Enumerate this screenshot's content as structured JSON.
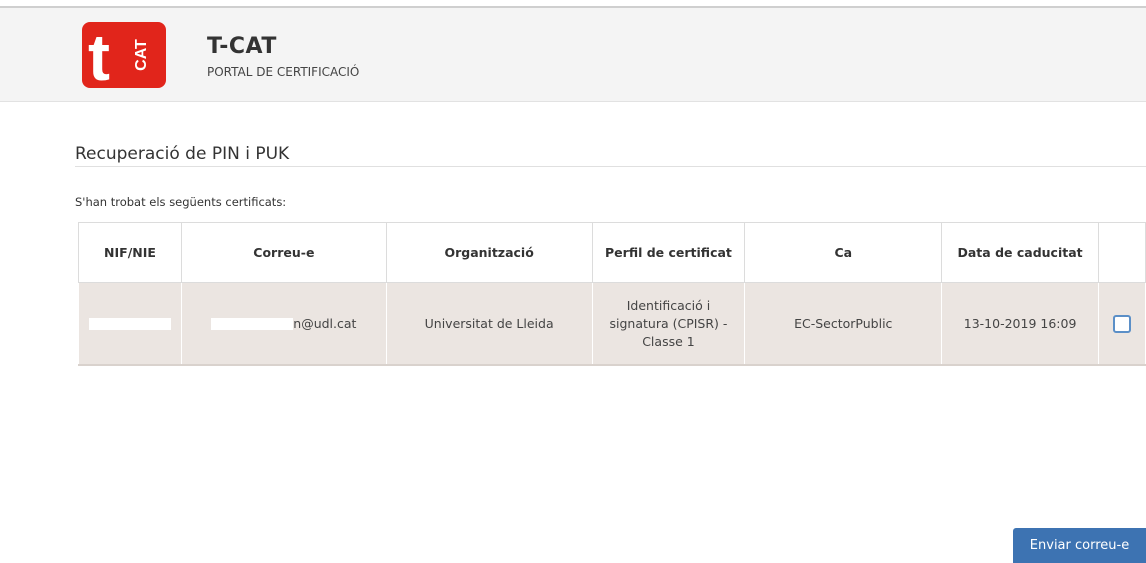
{
  "header": {
    "logo_alt": "tCAT",
    "title": "T-CAT",
    "subtitle": "PORTAL DE CERTIFICACIÓ"
  },
  "page": {
    "title": "Recuperació de PIN i PUK",
    "intro": "S'han trobat els següents certificats:"
  },
  "table": {
    "headers": [
      "NIF/NIE",
      "Correu-e",
      "Organització",
      "Perfil de certificat",
      "Ca",
      "Data de caducitat",
      ""
    ],
    "rows": [
      {
        "nif": "",
        "email_suffix": "n@udl.cat",
        "organization": "Universitat de Lleida",
        "profile": "Identificació i signatura (CPISR) - Classe 1",
        "ca": "EC-SectorPublic",
        "expiry": "13-10-2019 16:09",
        "selected": false
      }
    ]
  },
  "actions": {
    "send_label": "Enviar correu-e"
  },
  "colors": {
    "brand_red": "#e1251b",
    "button_blue": "#3d73b2",
    "row_bg": "#ebe5e1"
  }
}
